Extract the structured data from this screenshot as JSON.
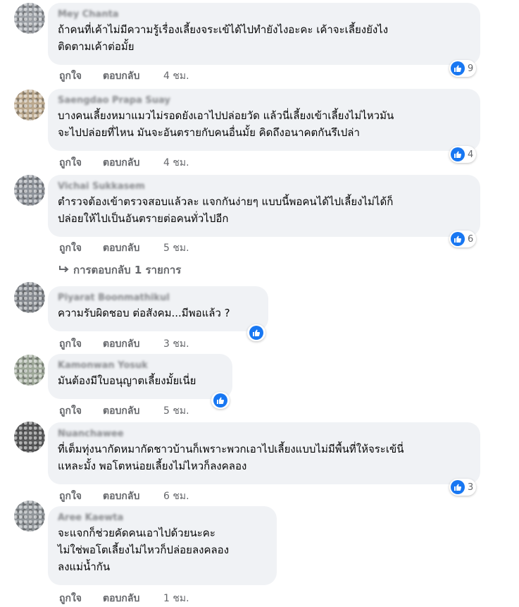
{
  "comments": [
    {
      "author": "Mey Chanta",
      "text": "ถ้าคนที่เค้าไม่มีความรู้เรื่องเลี้ยงจระเข้ได้ไปทำยังไงอะคะ เค้าจะเลี้ยงยังไง\nติดตามเค้าต่อมั้ย",
      "like": "ถูกใจ",
      "reply": "ตอบกลับ",
      "time": "4 ชม.",
      "reactions": "9"
    },
    {
      "author": "Saengdao Prapa Suay",
      "text": "บางคนเลี้ยงหมาแมวไม่รอดยังเอาไปปล่อยวัด แล้วนี่เลี้ยงเข้าเลี้ยงไม่ไหวมัน\nจะไปปล่อยที่ไหน มันจะอันตรายกับคนอื่นมั้ย คิดถึงอนาคตกันรึเปล่า",
      "like": "ถูกใจ",
      "reply": "ตอบกลับ",
      "time": "4 ชม.",
      "reactions": "4"
    },
    {
      "author": "Vichai Sukkasem",
      "text": "ตำรวจต้องเข้าตรวจสอบแล้วละ แจกกันง่ายๆ แบบนี้พอคนได้ไปเลี้ยงไม่ได้ก็\nปล่อยให้ไปเป็นอันตรายต่อคนทั่วไปอีก",
      "like": "ถูกใจ",
      "reply": "ตอบกลับ",
      "time": "5 ชม.",
      "reactions": "6"
    },
    {
      "author": "Piyarat Boonmathikul",
      "text": "ความรับผิดชอบ ต่อสังคม...มีพอแล้ว ?",
      "like": "ถูกใจ",
      "reply": "ตอบกลับ",
      "time": "3 ชม.",
      "reactions": ""
    },
    {
      "author": "Kamonwan Yosuk",
      "text": "มันต้องมีใบอนุญาตเลี้ยงมั้ยเนี่ย",
      "like": "ถูกใจ",
      "reply": "ตอบกลับ",
      "time": "5 ชม.",
      "reactions": ""
    },
    {
      "author": "Nuanchawee",
      "text": "ที่เต็มทุ่งนากัดหมากัดชาวบ้านก็เพราะพวกเอาไปเลี้ยงแบบไม่มีพื้นที่ให้จระเข้นี่\nแหละมั้ง พอโตหน่อยเลี้ยงไม่ไหวก็ลงคลอง",
      "like": "ถูกใจ",
      "reply": "ตอบกลับ",
      "time": "6 ชม.",
      "reactions": "3"
    },
    {
      "author": "Aree Kaewta",
      "text": "จะแจกก็ช่วยคัดคนเอาไปด้วยนะคะ\nไม่ใช่พอโตเลี้ยงไม่ไหวก็ปล่อยลงคลอง\nลงแม่น้ำกัน",
      "like": "ถูกใจ",
      "reply": "ตอบกลับ",
      "time": "1 ชม.",
      "reactions": ""
    }
  ],
  "replies_link": "การตอบกลับ 1 รายการ",
  "icons": {
    "like": "like-icon",
    "reply_arrow": "reply-arrow-icon"
  },
  "colors": {
    "bubble": "#f0f2f5",
    "like_blue": "#1877f2",
    "meta_text": "#65676b"
  }
}
